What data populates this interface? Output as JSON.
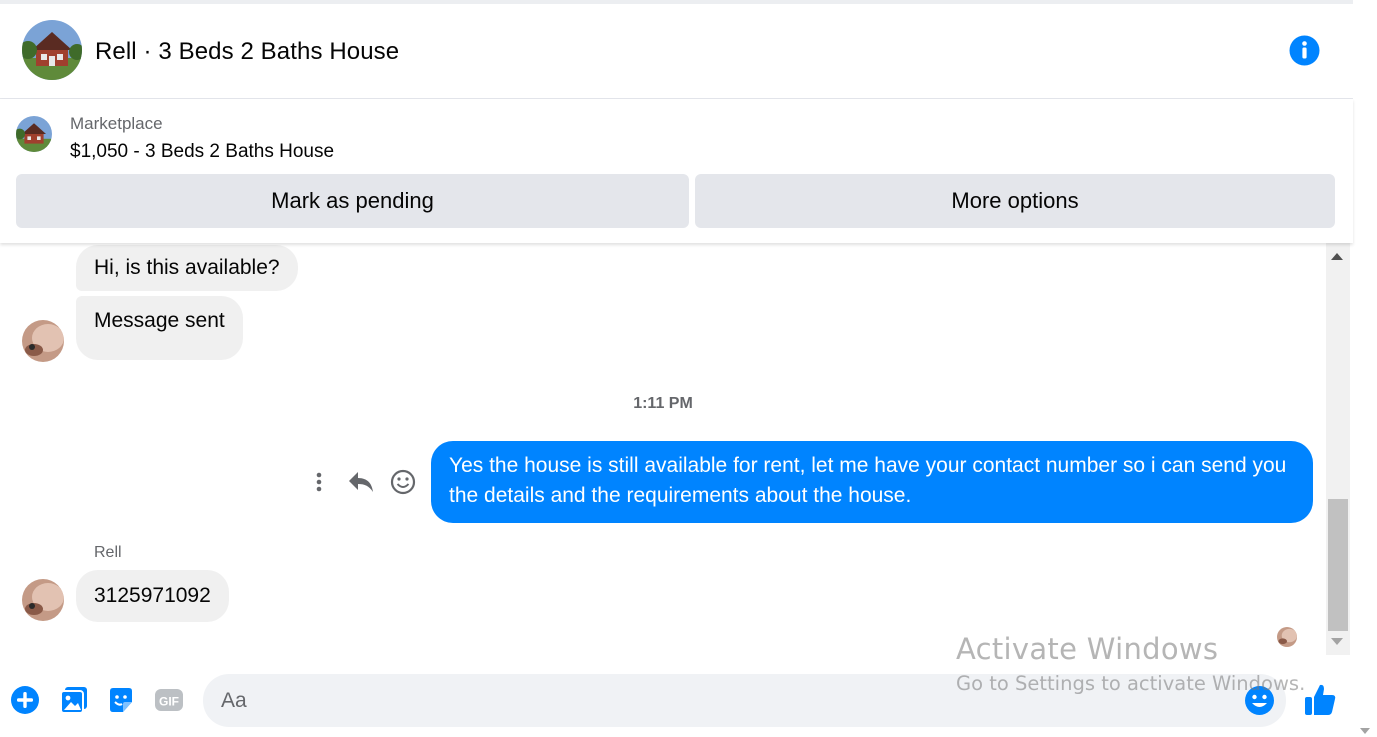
{
  "header": {
    "title": "Rell · 3 Beds 2 Baths House",
    "info_icon": "info-icon",
    "accent": "#0084ff"
  },
  "listing": {
    "label": "Marketplace",
    "title": "$1,050 - 3 Beds 2 Baths House",
    "mark_pending_label": "Mark as pending",
    "more_options_label": "More options"
  },
  "thread": {
    "messages_in_top": [
      {
        "text": "Hi, is this available?"
      },
      {
        "text": "Message sent"
      }
    ],
    "timestamp": "1:11 PM",
    "outgoing": {
      "text": "Yes the house is still available for rent, let me have your contact number so i can send you the details and the requirements about the house."
    },
    "sender_name": "Rell",
    "incoming_reply": {
      "text": "3125971092"
    },
    "actions": [
      "more-icon",
      "reply-icon",
      "react-icon"
    ]
  },
  "composer": {
    "placeholder": "Aa",
    "icons": [
      "plus-icon",
      "photo-icon",
      "sticker-icon",
      "gif-icon",
      "emoji-icon",
      "like-icon"
    ],
    "gif_label": "GIF"
  },
  "watermark": {
    "line1": "Activate Windows",
    "line2": "Go to Settings to activate Windows."
  }
}
